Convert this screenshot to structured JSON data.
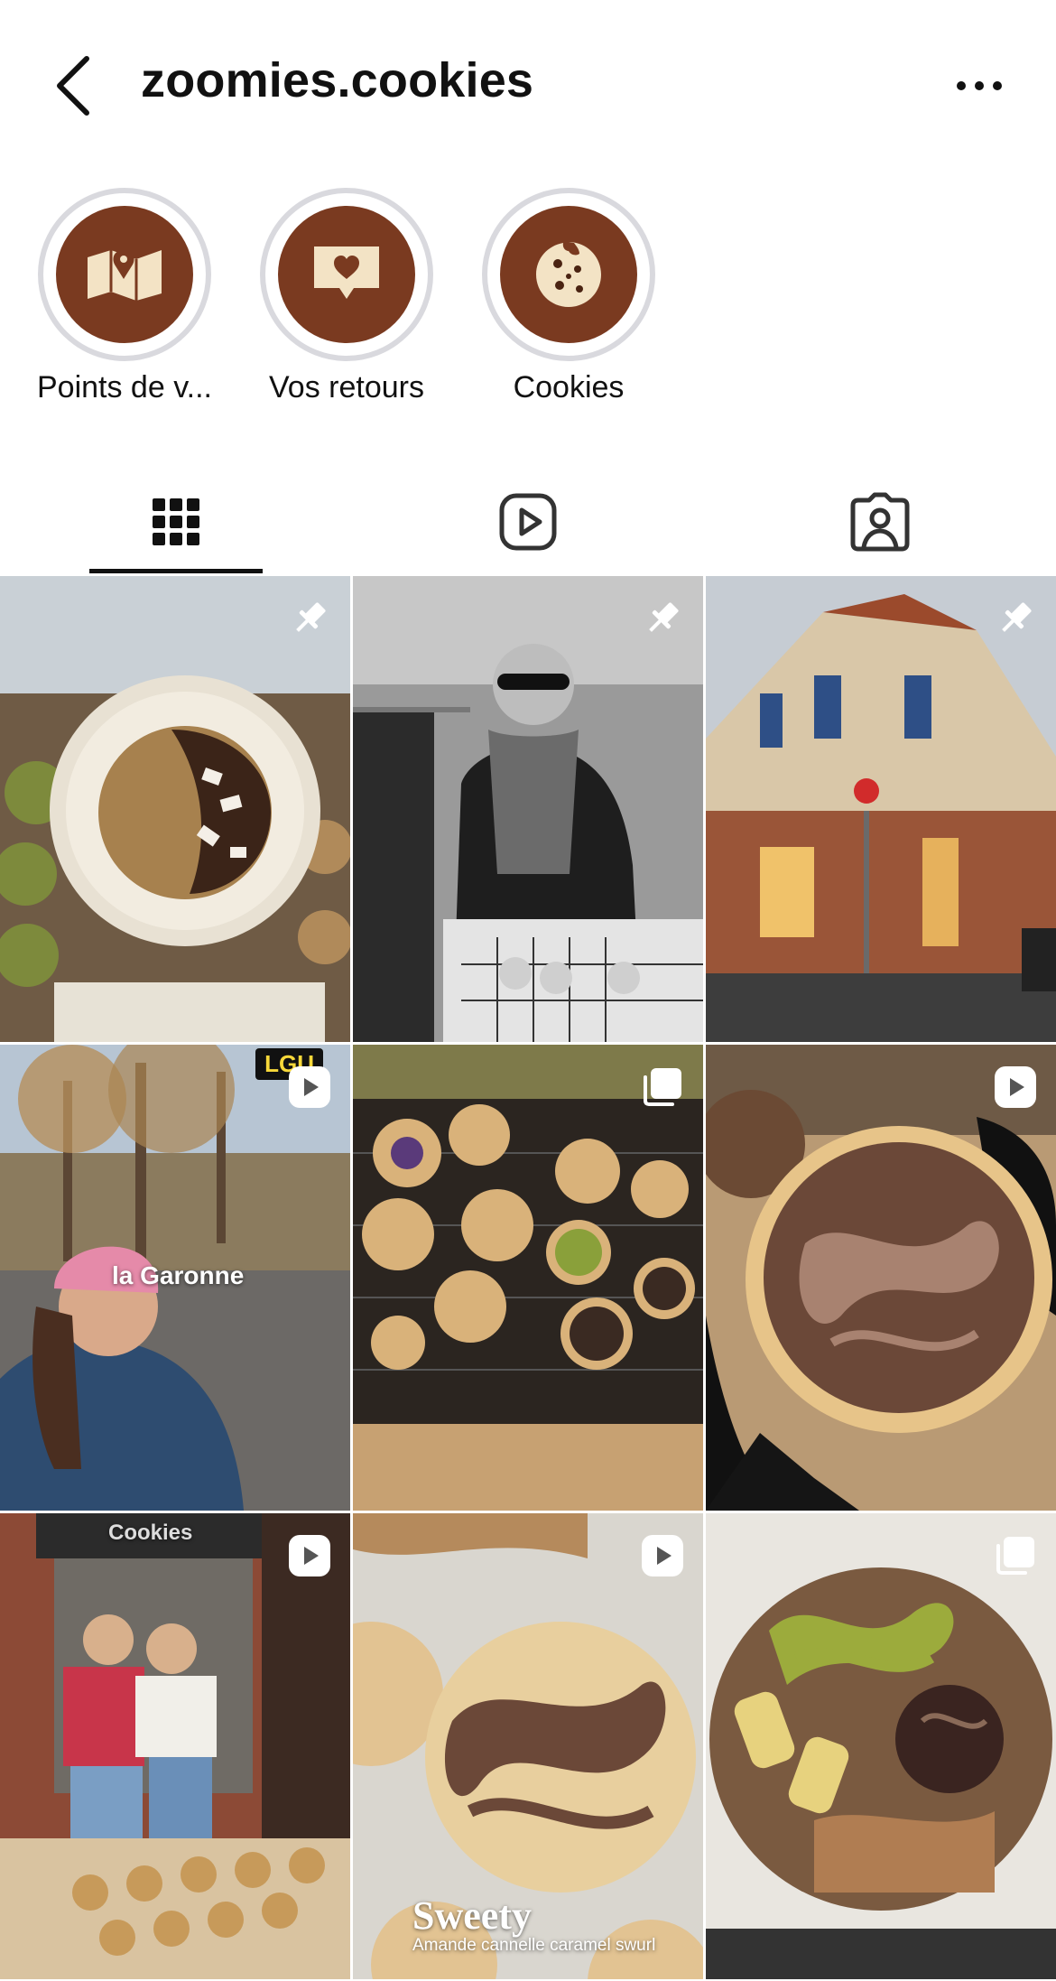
{
  "header": {
    "title": "zoomies.cookies"
  },
  "highlights": [
    {
      "label": "Points de v...",
      "icon": "map-pin-icon"
    },
    {
      "label": "Vos retours",
      "icon": "heart-message-icon"
    },
    {
      "label": "Cookies",
      "icon": "cookie-icon"
    }
  ],
  "tabs": [
    {
      "name": "posts",
      "icon": "grid-icon",
      "active": true
    },
    {
      "name": "reels",
      "icon": "reels-icon",
      "active": false
    },
    {
      "name": "tagged",
      "icon": "tagged-user-icon",
      "active": false
    }
  ],
  "posts": [
    {
      "badge": "pin-icon"
    },
    {
      "badge": "pin-icon"
    },
    {
      "badge": "pin-icon"
    },
    {
      "badge": "reel-icon",
      "sticker": "LGU",
      "caption": "la Garonne"
    },
    {
      "badge": "carousel-icon"
    },
    {
      "badge": "reel-icon"
    },
    {
      "badge": "reel-icon",
      "sign": "Cookies"
    },
    {
      "badge": "reel-icon",
      "caption": "Sweety",
      "subcaption": "Amande cannelle caramel swurl"
    },
    {
      "badge": "carousel-icon"
    }
  ],
  "colors": {
    "highlight_bg": "#7a3a20",
    "highlight_ring": "#d9d9de",
    "icon_cream": "#f3e3c5"
  }
}
